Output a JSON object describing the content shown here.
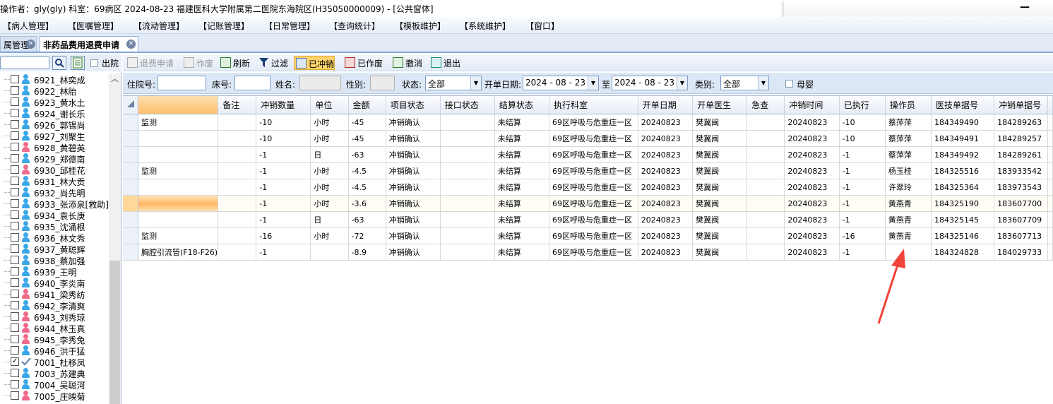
{
  "window": {
    "title": "操作者：gly(gly)  科室：69病区  2024-08-23  福建医科大学附属第二医院东海院区(H35050000009) - [公共窗体]",
    "minimize": "—"
  },
  "menu": [
    "【病人管理】",
    "【医嘱管理】",
    "【流动管理】",
    "【记账管理】",
    "【日常管理】",
    "【查询统计】",
    "【模板维护】",
    "【系统维护】",
    "【窗口】"
  ],
  "tabs": [
    {
      "label": "属管理",
      "active": false
    },
    {
      "label": "非药品费用退费申请",
      "active": true
    }
  ],
  "left_panel": {
    "search_value": "",
    "out_label": "出院",
    "patients": [
      {
        "label": "6921_林奕成",
        "gender": "male",
        "checked": false
      },
      {
        "label": "6922_林胎",
        "gender": "male",
        "checked": false
      },
      {
        "label": "6923_黄水土",
        "gender": "male",
        "checked": false
      },
      {
        "label": "6924_谢长乐",
        "gender": "male",
        "checked": false
      },
      {
        "label": "6926_郭锡尚",
        "gender": "male",
        "checked": false
      },
      {
        "label": "6927_刘聚生",
        "gender": "male",
        "checked": false
      },
      {
        "label": "6928_黄碧英",
        "gender": "female",
        "checked": false
      },
      {
        "label": "6929_郑德南",
        "gender": "male",
        "checked": false
      },
      {
        "label": "6930_邱桂花",
        "gender": "female",
        "checked": false
      },
      {
        "label": "6931_林大贡",
        "gender": "male",
        "checked": false
      },
      {
        "label": "6932_尚先明",
        "gender": "male",
        "checked": false
      },
      {
        "label": "6933_张添泉[救助]",
        "gender": "male",
        "checked": false
      },
      {
        "label": "6934_袁长庚",
        "gender": "male",
        "checked": false
      },
      {
        "label": "6935_沈涌根",
        "gender": "male",
        "checked": false
      },
      {
        "label": "6936_林文秀",
        "gender": "male",
        "checked": false
      },
      {
        "label": "6937_黄聪辉",
        "gender": "male",
        "checked": false
      },
      {
        "label": "6938_蔡加强",
        "gender": "male",
        "checked": false
      },
      {
        "label": "6939_王明",
        "gender": "male",
        "checked": false
      },
      {
        "label": "6940_李炎南",
        "gender": "male",
        "checked": false
      },
      {
        "label": "6941_梁秀纺",
        "gender": "female",
        "checked": false
      },
      {
        "label": "6942_李清爽",
        "gender": "male",
        "checked": false
      },
      {
        "label": "6943_刘秀琼",
        "gender": "female",
        "checked": false
      },
      {
        "label": "6944_林玉真",
        "gender": "female",
        "checked": false
      },
      {
        "label": "6945_李秀兔",
        "gender": "female",
        "checked": false
      },
      {
        "label": "6946_洪于猛",
        "gender": "male",
        "checked": false
      },
      {
        "label": "7001_杜移凤",
        "gender": "check",
        "checked": true
      },
      {
        "label": "7003_苏建典",
        "gender": "male",
        "checked": false
      },
      {
        "label": "7004_吴聪河",
        "gender": "male",
        "checked": false
      },
      {
        "label": "7005_庄映菊",
        "gender": "female",
        "checked": false
      }
    ]
  },
  "toolbar": {
    "refund_apply": "退费申请",
    "void": "作废",
    "refresh": "刷新",
    "filter": "过滤",
    "reversed": "已冲销",
    "voided": "已作废",
    "undo": "撤消",
    "exit": "退出"
  },
  "filters": {
    "admission_label": "住院号:",
    "admission_value": "",
    "bed_label": "床号:",
    "bed_value": "",
    "name_label": "姓名:",
    "name_value": "",
    "sex_label": "性别:",
    "sex_value": "",
    "status_label": "状态:",
    "status_value": "全部",
    "date_label": "开单日期:",
    "date_from": "2024 - 08 - 23",
    "to_label": "至",
    "date_to": "2024 - 08 - 23",
    "type_label": "类别:",
    "type_value": "全部",
    "infant_label": "母婴"
  },
  "grid": {
    "columns": [
      "",
      "备注",
      "冲销数量",
      "单位",
      "金额",
      "项目状态",
      "接口状态",
      "结算状态",
      "执行科室",
      "开单日期",
      "开单医生",
      "急查",
      "冲销时间",
      "已执行",
      "操作员",
      "医技单据号",
      "冲销单据号"
    ],
    "rows": [
      {
        "name": "监测",
        "remark": "",
        "qty": "-10",
        "unit": "小时",
        "amount": "-45",
        "item_status": "冲销确认",
        "iface_status": "",
        "settle_status": "未结算",
        "dept": "69区呼吸与危重症一区",
        "date": "20240823",
        "doctor": "樊冀闽",
        "urgent": "",
        "reverse_time": "20240823",
        "executed": "-10",
        "operator": "蔡萍萍",
        "tech_no": "184349490",
        "reverse_no": "184289263",
        "selected": false
      },
      {
        "name": "",
        "remark": "",
        "qty": "-10",
        "unit": "小时",
        "amount": "-45",
        "item_status": "冲销确认",
        "iface_status": "",
        "settle_status": "未结算",
        "dept": "69区呼吸与危重症一区",
        "date": "20240823",
        "doctor": "樊冀闽",
        "urgent": "",
        "reverse_time": "20240823",
        "executed": "-10",
        "operator": "蔡萍萍",
        "tech_no": "184349491",
        "reverse_no": "184289257",
        "selected": false
      },
      {
        "name": "",
        "remark": "",
        "qty": "-1",
        "unit": "日",
        "amount": "-63",
        "item_status": "冲销确认",
        "iface_status": "",
        "settle_status": "未结算",
        "dept": "69区呼吸与危重症一区",
        "date": "20240823",
        "doctor": "樊冀闽",
        "urgent": "",
        "reverse_time": "20240823",
        "executed": "-1",
        "operator": "蔡萍萍",
        "tech_no": "184349492",
        "reverse_no": "184289261",
        "selected": false
      },
      {
        "name": "监测",
        "remark": "",
        "qty": "-1",
        "unit": "小时",
        "amount": "-4.5",
        "item_status": "冲销确认",
        "iface_status": "",
        "settle_status": "未结算",
        "dept": "69区呼吸与危重症一区",
        "date": "20240823",
        "doctor": "樊冀闽",
        "urgent": "",
        "reverse_time": "20240823",
        "executed": "-1",
        "operator": "杨玉桂",
        "tech_no": "184325516",
        "reverse_no": "183933542",
        "selected": false
      },
      {
        "name": "",
        "remark": "",
        "qty": "-1",
        "unit": "小时",
        "amount": "-4.5",
        "item_status": "冲销确认",
        "iface_status": "",
        "settle_status": "未结算",
        "dept": "69区呼吸与危重症一区",
        "date": "20240823",
        "doctor": "樊冀闽",
        "urgent": "",
        "reverse_time": "20240823",
        "executed": "-1",
        "operator": "许翠玲",
        "tech_no": "184325364",
        "reverse_no": "183973543",
        "selected": false
      },
      {
        "name": "",
        "remark": "",
        "qty": "-1",
        "unit": "小时",
        "amount": "-3.6",
        "item_status": "冲销确认",
        "iface_status": "",
        "settle_status": "未结算",
        "dept": "69区呼吸与危重症一区",
        "date": "20240823",
        "doctor": "樊冀闽",
        "urgent": "",
        "reverse_time": "20240823",
        "executed": "-1",
        "operator": "黄燕青",
        "tech_no": "184325190",
        "reverse_no": "183607700",
        "selected": true
      },
      {
        "name": "",
        "remark": "",
        "qty": "-1",
        "unit": "日",
        "amount": "-63",
        "item_status": "冲销确认",
        "iface_status": "",
        "settle_status": "未结算",
        "dept": "69区呼吸与危重症一区",
        "date": "20240823",
        "doctor": "樊冀闽",
        "urgent": "",
        "reverse_time": "20240823",
        "executed": "-1",
        "operator": "黄燕青",
        "tech_no": "184325145",
        "reverse_no": "183607709",
        "selected": false
      },
      {
        "name": "监测",
        "remark": "",
        "qty": "-16",
        "unit": "小时",
        "amount": "-72",
        "item_status": "冲销确认",
        "iface_status": "",
        "settle_status": "未结算",
        "dept": "69区呼吸与危重症一区",
        "date": "20240823",
        "doctor": "樊冀闽",
        "urgent": "",
        "reverse_time": "20240823",
        "executed": "-16",
        "operator": "黄燕青",
        "tech_no": "184325146",
        "reverse_no": "183607713",
        "selected": false
      },
      {
        "name": "胸腔引流管(F18-F26)",
        "remark": "",
        "qty": "-1",
        "unit": "",
        "amount": "-8.9",
        "item_status": "冲销确认",
        "iface_status": "",
        "settle_status": "未结算",
        "dept": "69区呼吸与危重症一区",
        "date": "20240823",
        "doctor": "樊冀闽",
        "urgent": "",
        "reverse_time": "20240823",
        "executed": "-1",
        "operator": "",
        "tech_no": "184324828",
        "reverse_no": "184029733",
        "selected": false
      }
    ]
  },
  "colors": {
    "male_icon": "#3aa7e8",
    "female_icon": "#f06a8a",
    "annotation_arrow": "#f0433a",
    "selected_row": "#ffb760"
  }
}
